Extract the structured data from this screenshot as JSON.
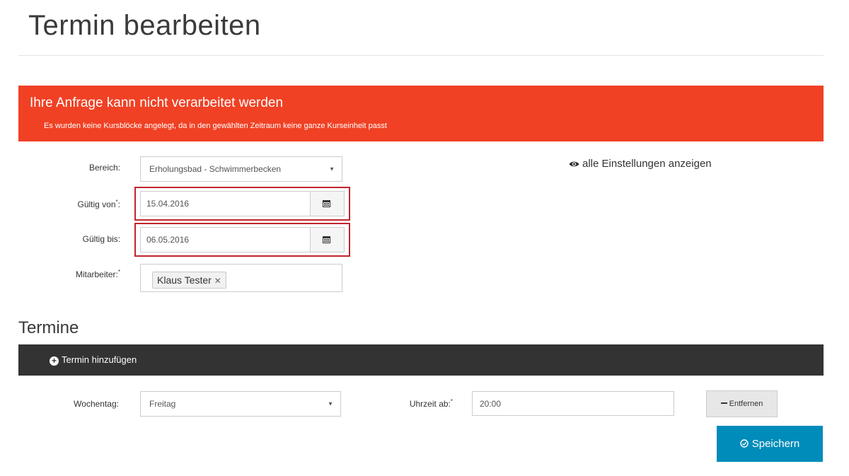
{
  "page": {
    "title": "Termin bearbeiten"
  },
  "alert": {
    "title": "Ihre Anfrage kann nicht verarbeitet werden",
    "message": "Es wurden keine Kursblöcke angelegt, da in den gewählten Zeitraum keine ganze Kurseinheit passt"
  },
  "form": {
    "bereich": {
      "label": "Bereich:",
      "value": "Erholungsbad - Schwimmerbecken"
    },
    "gueltig_von": {
      "label": "Gültig von",
      "required_mark": "*",
      "suffix": ":",
      "value": "15.04.2016"
    },
    "gueltig_bis": {
      "label": "Gültig bis:",
      "value": "06.05.2016"
    },
    "mitarbeiter": {
      "label": "Mitarbeiter:",
      "required_mark": "*",
      "tags": [
        "Klaus Tester"
      ],
      "remove_glyph": "✕"
    }
  },
  "show_all_settings": "alle Einstellungen anzeigen",
  "termine": {
    "title": "Termine",
    "add_label": "Termin hinzufügen",
    "wochentag": {
      "label": "Wochentag:",
      "value": "Freitag"
    },
    "uhrzeit": {
      "label": "Uhrzeit ab:",
      "required_mark": "*",
      "value": "20:00"
    },
    "remove_label": "Entfernen"
  },
  "save_label": "Speichern",
  "colors": {
    "alert_bg": "#f04124",
    "error_outline": "#c0262c",
    "dark_bar": "#333333",
    "primary_button": "#008cba"
  },
  "icons": {
    "calendar": "calendar-icon",
    "eye": "eye-icon",
    "plus": "plus-circle-icon",
    "minus": "minus-icon",
    "check": "check-circle-icon",
    "caret": "caret-down-icon"
  }
}
